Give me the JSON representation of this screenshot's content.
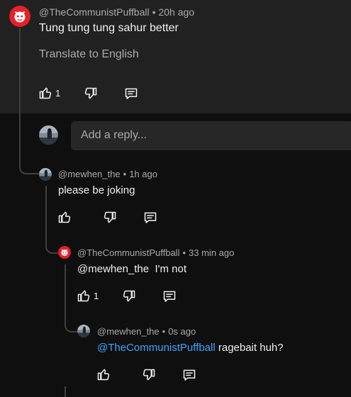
{
  "main_comment": {
    "author": "@TheCommunistPuffball",
    "time": "20h ago",
    "text": "Tung tung tung sahur better",
    "translate": "Translate to English",
    "likes": "1"
  },
  "reply_input": {
    "placeholder": "Add a reply..."
  },
  "replies": [
    {
      "author": "@mewhen_the",
      "time": "1h ago",
      "text": "please be joking",
      "likes": ""
    },
    {
      "author": "@TheCommunistPuffball",
      "time": "33 min ago",
      "text": "@mewhen_the  I'm not",
      "likes": "1"
    },
    {
      "author": "@mewhen_the",
      "time": "0s ago",
      "mention": "@TheCommunistPuffball",
      "text": " ragebait huh?",
      "likes": ""
    }
  ],
  "colors": {
    "mention": "#3ea6ff",
    "avatar_red": "#e8202a",
    "panel": "#212121",
    "background": "#0f0f0f"
  },
  "icons": [
    "like-icon",
    "dislike-icon",
    "reply-icon"
  ]
}
